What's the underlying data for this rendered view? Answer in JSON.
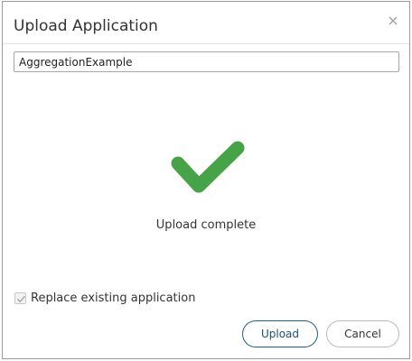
{
  "dialog": {
    "title": "Upload Application",
    "close_icon": "close-icon"
  },
  "name_field": {
    "value": "AggregationExample"
  },
  "status": {
    "icon": "checkmark-icon",
    "icon_color": "#47a347",
    "text": "Upload complete"
  },
  "replace_option": {
    "label": "Replace existing application",
    "checked": true,
    "disabled": true
  },
  "buttons": {
    "upload_label": "Upload",
    "cancel_label": "Cancel"
  },
  "colors": {
    "upload_border": "#1d5f86",
    "cancel_border": "#b9b9b9"
  }
}
